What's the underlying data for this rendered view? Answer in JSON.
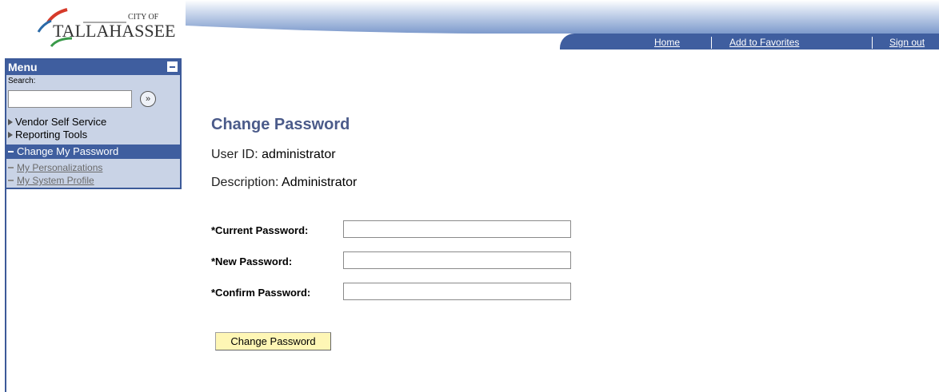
{
  "header": {
    "logo_small": "CITY OF",
    "logo_main": "TALLAHASSEE",
    "nav": [
      {
        "label": "Home"
      },
      {
        "label": "Add to Favorites"
      },
      {
        "label": "Sign out"
      }
    ]
  },
  "menu": {
    "title": "Menu",
    "search_label": "Search:",
    "search_value": "",
    "items": [
      {
        "label": "Vendor Self Service"
      },
      {
        "label": "Reporting Tools"
      },
      {
        "label": "Change My Password"
      },
      {
        "label": "My Personalizations"
      },
      {
        "label": "My System Profile"
      }
    ]
  },
  "main": {
    "title": "Change Password",
    "user_id_label": "User ID:",
    "user_id_value": "administrator",
    "description_label": "Description:",
    "description_value": "Administrator",
    "fields": [
      {
        "label": "*Current Password:",
        "value": ""
      },
      {
        "label": "*New Password:",
        "value": ""
      },
      {
        "label": "*Confirm Password:",
        "value": ""
      }
    ],
    "submit_label": "Change Password"
  },
  "colors": {
    "brand_blue": "#3f5e9f",
    "title_blue": "#4b5b8a",
    "button_yellow": "#fef6b5",
    "menu_bg": "#c9d3e6"
  }
}
